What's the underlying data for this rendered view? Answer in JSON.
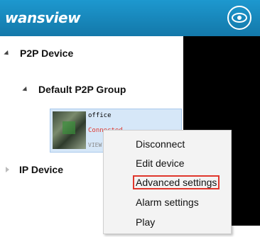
{
  "header": {
    "logo_text": "wansview",
    "eye_icon": "eye-icon",
    "color": "#1888bf"
  },
  "tree": {
    "p2p_label": "P2P Device",
    "group_label": "Default P2P Group",
    "ip_label": "IP Device",
    "device": {
      "name": "office",
      "status": "Connected",
      "model": "VIEW"
    }
  },
  "context_menu": {
    "items": [
      {
        "label": "Disconnect"
      },
      {
        "label": "Edit device"
      },
      {
        "label": "Advanced settings"
      },
      {
        "label": "Alarm settings"
      },
      {
        "label": "Play"
      }
    ],
    "highlight_color": "#e0362c"
  }
}
